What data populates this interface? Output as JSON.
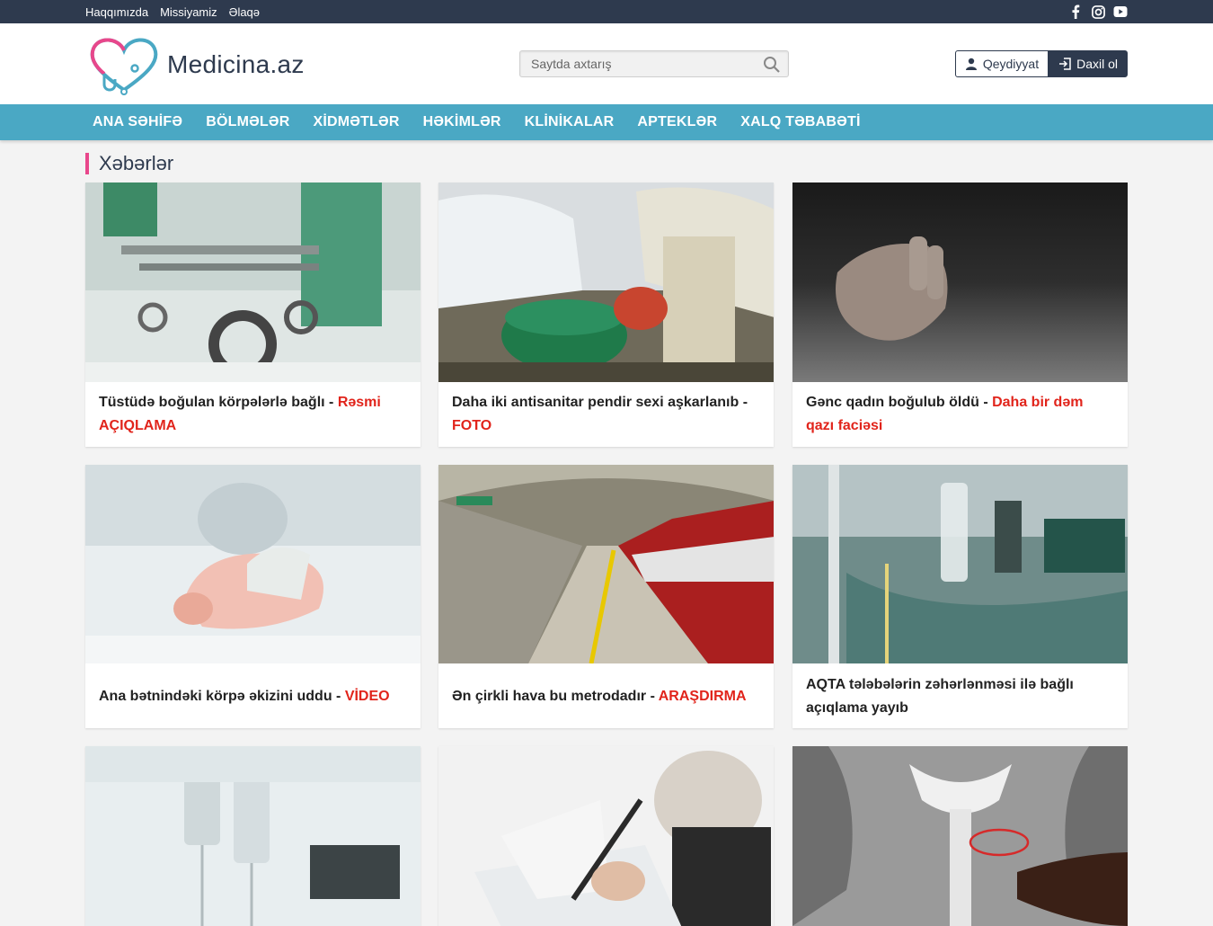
{
  "topbar": {
    "links": [
      "Haqqımızda",
      "Missiyamiz",
      "Əlaqə"
    ],
    "social": [
      "facebook-icon",
      "instagram-icon",
      "youtube-icon"
    ]
  },
  "header": {
    "brand": "Medicina.az",
    "search_placeholder": "Saytda axtarış",
    "register_label": "Qeydiyyat",
    "login_label": "Daxil ol"
  },
  "nav": {
    "items": [
      "ANA SƏHİFƏ",
      "BÖLMƏLƏR",
      "XİDMƏTLƏR",
      "HƏKİMLƏR",
      "KLİNİKALAR",
      "APTEKLƏR",
      "XALQ TƏBABƏTİ"
    ]
  },
  "section_title": "Xəbərlər",
  "colors": {
    "topbar": "#2e3a4e",
    "nav": "#4aa8c4",
    "accent_pink": "#e8478b",
    "tag_red": "#e1241b"
  },
  "articles": [
    {
      "title": "Tüstüdə boğulan körpələrlə bağlı - ",
      "tag": "Rəsmi AÇIQLAMA"
    },
    {
      "title": "Daha iki antisanitar pendir sexi aşkarlanıb - ",
      "tag": "FOTO"
    },
    {
      "title": "Gənc qadın boğulub öldü - ",
      "tag": "Daha bir dəm qazı faciəsi"
    },
    {
      "title": "Ana bətnindəki körpə əkizini uddu - ",
      "tag": "VİDEO"
    },
    {
      "title": "Ən çirkli hava bu metrodadır - ",
      "tag": "ARAŞDIRMA"
    },
    {
      "title": "AQTA tələbələrin zəhərlənməsi ilə bağlı açıqlama yayıb",
      "tag": ""
    },
    {
      "title": "",
      "tag": ""
    },
    {
      "title": "",
      "tag": ""
    },
    {
      "title": "",
      "tag": ""
    }
  ]
}
